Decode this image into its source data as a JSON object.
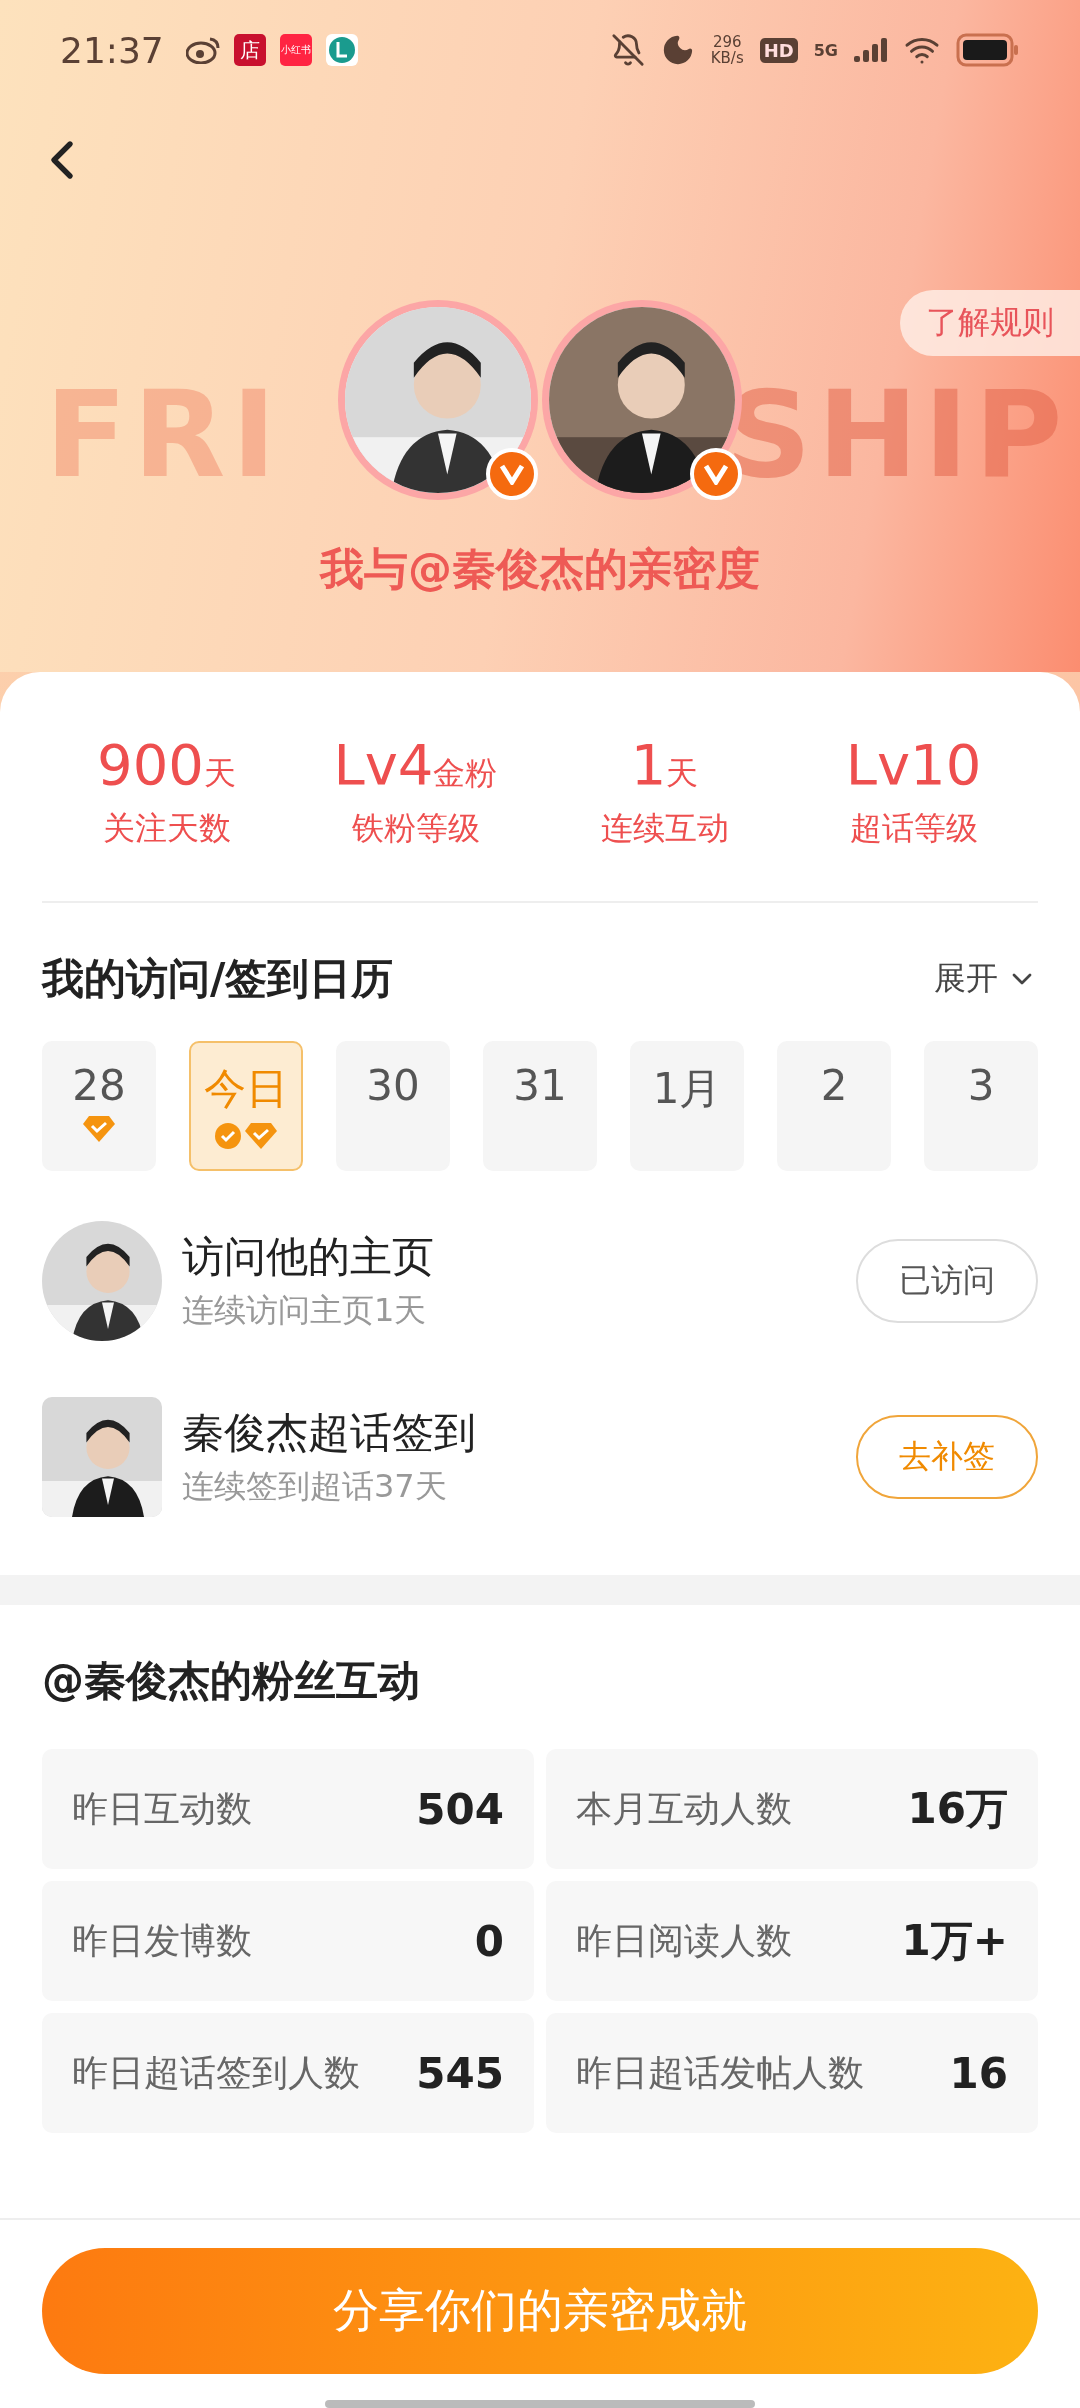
{
  "status_bar": {
    "time": "21:37",
    "notifications": [
      {
        "kind": "weibo"
      },
      {
        "kind": "shop",
        "text": "店"
      },
      {
        "kind": "redbook",
        "text": "小红书"
      },
      {
        "kind": "app"
      }
    ],
    "speed_value": "296",
    "speed_unit": "KB/s",
    "hd": "HD",
    "network": "5G"
  },
  "header": {
    "background_left": "FRI",
    "background_right": "SHIP",
    "rules_button": "了解规则",
    "avatars": [
      {
        "kind": "portrait",
        "verified": true
      },
      {
        "kind": "suit",
        "verified": true
      }
    ],
    "title": "我与@秦俊杰的亲密度"
  },
  "stats": [
    {
      "value": "900",
      "unit": "天",
      "label": "关注天数"
    },
    {
      "value": "Lv4",
      "unit": "金粉",
      "label": "铁粉等级"
    },
    {
      "value": "1",
      "unit": "天",
      "label": "连续互动"
    },
    {
      "value": "Lv10",
      "label": "超话等级"
    }
  ],
  "calendar": {
    "title": "我的访问/签到日历",
    "toggle": "展开",
    "expanded": false,
    "days": [
      {
        "label": "28",
        "selected": false,
        "visited": false,
        "signed": true
      },
      {
        "label": "今日",
        "selected": true,
        "visited": true,
        "signed": true
      },
      {
        "label": "30",
        "selected": false,
        "visited": false,
        "signed": false
      },
      {
        "label": "31",
        "selected": false,
        "visited": false,
        "signed": false
      },
      {
        "label": "1月",
        "selected": false,
        "visited": false,
        "signed": false
      },
      {
        "label": "2",
        "selected": false,
        "visited": false,
        "signed": false
      },
      {
        "label": "3",
        "selected": false,
        "visited": false,
        "signed": false
      }
    ]
  },
  "tasks": [
    {
      "kind": "round",
      "title": "访问他的主页",
      "subtitle": "连续访问主页1天",
      "button": "已访问",
      "done": true
    },
    {
      "kind": "square",
      "title": "秦俊杰超话签到",
      "subtitle": "连续签到超话37天",
      "button": "去补签",
      "done": false
    }
  ],
  "fan_section": {
    "title": "@秦俊杰的粉丝互动",
    "metrics": [
      {
        "label": "昨日互动数",
        "value": "504"
      },
      {
        "label": "本月互动人数",
        "value": "16万"
      },
      {
        "label": "昨日发博数",
        "value": "0"
      },
      {
        "label": "昨日阅读人数",
        "value": "1万+"
      },
      {
        "label": "昨日超话签到人数",
        "value": "545"
      },
      {
        "label": "昨日超话发帖人数",
        "value": "16"
      }
    ]
  },
  "share_button": "分享你们的亲密成就"
}
